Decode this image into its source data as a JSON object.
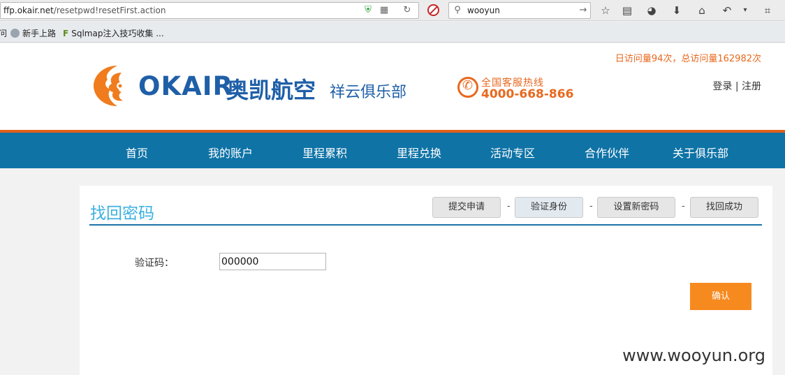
{
  "browser": {
    "url_domain": "ffp.okair.net",
    "url_path": "/resetpwd!resetFirst.action",
    "search_value": "wooyun",
    "bookmarks": [
      {
        "label": "问"
      },
      {
        "label": "新手上路"
      },
      {
        "label": "Sqlmap注入技巧收集 ..."
      }
    ]
  },
  "header": {
    "visit_stats": "日访问量94次，总访问量162982次",
    "login": "登录",
    "separator": "|",
    "register": "注册",
    "logo_en": "OKAIR",
    "logo_cn": "奥凯航空",
    "logo_club": "祥云俱乐部",
    "hotline_label": "全国客服热线",
    "hotline_number": "4000-668-866"
  },
  "nav": {
    "items": [
      "首页",
      "我的账户",
      "里程累积",
      "里程兑换",
      "活动专区",
      "合作伙伴",
      "关于俱乐部"
    ]
  },
  "main": {
    "title": "找回密码",
    "steps": [
      "提交申请",
      "验证身份",
      "设置新密码",
      "找回成功"
    ],
    "step_separator": "-",
    "code_label": "验证码：",
    "code_value": "000000",
    "confirm_label": "确认"
  },
  "watermark": "www.wooyun.org",
  "colors": {
    "nav_bg": "#0f73a6",
    "accent_orange": "#e8681e",
    "confirm_button": "#f78a1f",
    "title_blue": "#3ab0e0"
  }
}
